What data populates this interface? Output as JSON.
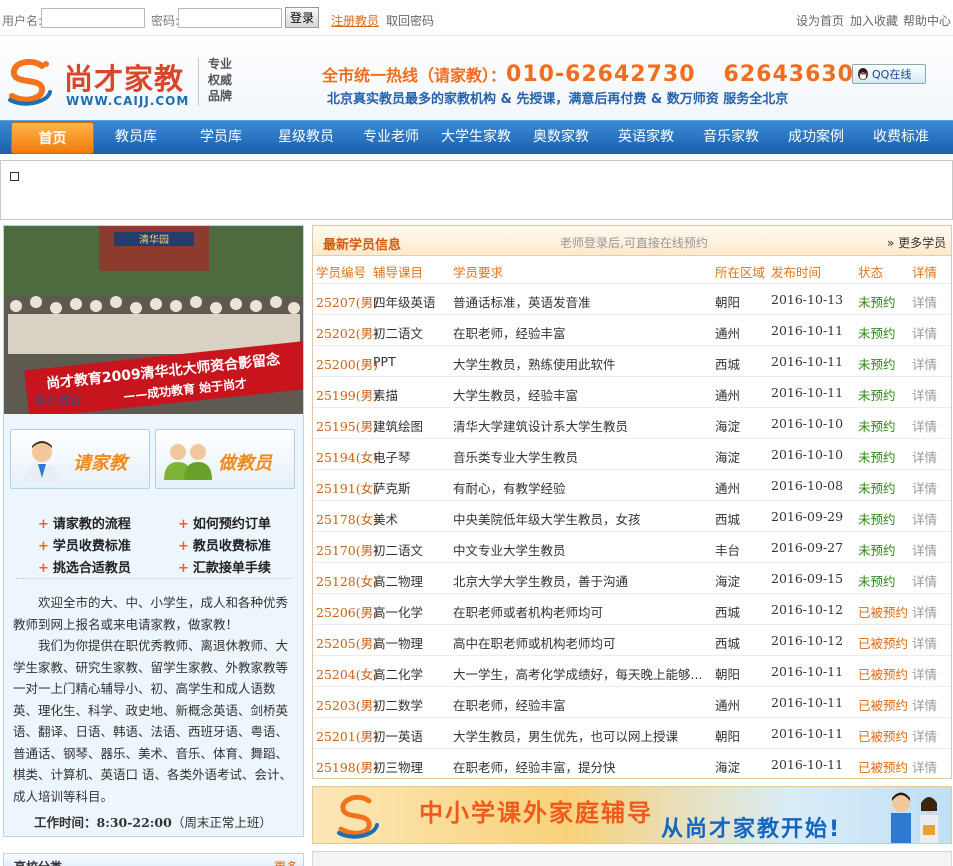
{
  "topbar": {
    "username_label": "用户名:",
    "password_label": "密码:",
    "login_button": "登录",
    "register_link": "注册教员",
    "recover_link": "取回密码",
    "links": [
      "设为首页",
      "加入收藏",
      "帮助中心"
    ]
  },
  "header": {
    "logo_text": "尚才家教",
    "logo_url": "WWW.CAIJJ.COM",
    "slogan": [
      "专业",
      "权威",
      "品牌"
    ],
    "hotline_label": "全市统一热线（请家教）：",
    "hotline_1": "010-62642730",
    "hotline_2": "62643630",
    "subline": "北京真实教员最多的家教机构 & 先授课，满意后再付费 & 数万师资 服务全北京",
    "qq_button": "QQ在线"
  },
  "nav": {
    "items": [
      "首页",
      "教员库",
      "学员库",
      "星级教员",
      "专业老师",
      "大学生家教",
      "奥数家教",
      "英语家教",
      "音乐家教",
      "成功案例",
      "收费标准"
    ]
  },
  "left": {
    "photo_caption_1": "尚才教育2009清华北大师资合影留念",
    "photo_caption_2": "——成功教育 始于尚才",
    "photo_gate": "清华园",
    "photo_watermark": "尚才教育",
    "btn_request": "请家教",
    "btn_teacher": "做教员",
    "links": [
      "请家教的流程",
      "如何预约订单",
      "学员收费标准",
      "教员收费标准",
      "挑选合适教员",
      "汇款接单手续"
    ],
    "intro_1": "欢迎全市的大、中、小学生，成人和各种优秀教师到网上报名或来电请家教，做家教！",
    "intro_2": "我们为你提供在职优秀教师、离退休教师、大学生家教、研究生家教、留学生家教、外教家教等一对一上门精心辅导小、初、高学生和成人语数英、理化生、科学、政史地、新概念英语、剑桥英语、翻译、日语、韩语、法语、西班牙语、粤语、普通话、钢琴、器乐、美术、音乐、体育、舞蹈、棋类、计算机、英语口 语、各类外语考试、会计、成人培训等科目。",
    "worktime_label": "工作时间：",
    "worktime_value": "8:30-22:00",
    "worktime_note": "（周末正常上班）",
    "bottom_title": "高校分类",
    "bottom_more": "更多"
  },
  "panel": {
    "title": "最新学员信息",
    "center_note": "老师登录后,可直接在线预约",
    "more": "» 更多学员",
    "columns": [
      "学员编号",
      "辅导课目",
      "学员要求",
      "所在区域",
      "发布时间",
      "状态",
      "详情"
    ],
    "rows": [
      {
        "id": "25207(男)",
        "course": "四年级英语",
        "req": "普通话标准，英语发音准",
        "area": "朝阳",
        "date": "2016-10-13",
        "status": "未预约",
        "detail": "详情"
      },
      {
        "id": "25202(男)",
        "course": "初二语文",
        "req": "在职老师，经验丰富",
        "area": "通州",
        "date": "2016-10-11",
        "status": "未预约",
        "detail": "详情"
      },
      {
        "id": "25200(男)",
        "course": "PPT",
        "req": "大学生教员，熟练使用此软件",
        "area": "西城",
        "date": "2016-10-11",
        "status": "未预约",
        "detail": "详情"
      },
      {
        "id": "25199(男)",
        "course": "素描",
        "req": "大学生教员，经验丰富",
        "area": "通州",
        "date": "2016-10-11",
        "status": "未预约",
        "detail": "详情"
      },
      {
        "id": "25195(男)",
        "course": "建筑绘图",
        "req": "清华大学建筑设计系大学生教员",
        "area": "海淀",
        "date": "2016-10-10",
        "status": "未预约",
        "detail": "详情"
      },
      {
        "id": "25194(女)",
        "course": "电子琴",
        "req": "音乐类专业大学生教员",
        "area": "海淀",
        "date": "2016-10-10",
        "status": "未预约",
        "detail": "详情"
      },
      {
        "id": "25191(女)",
        "course": "萨克斯",
        "req": "有耐心，有教学经验",
        "area": "通州",
        "date": "2016-10-08",
        "status": "未预约",
        "detail": "详情"
      },
      {
        "id": "25178(女)",
        "course": "美术",
        "req": "中央美院低年级大学生教员，女孩",
        "area": "西城",
        "date": "2016-09-29",
        "status": "未预约",
        "detail": "详情"
      },
      {
        "id": "25170(男)",
        "course": "初二语文",
        "req": "中文专业大学生教员",
        "area": "丰台",
        "date": "2016-09-27",
        "status": "未预约",
        "detail": "详情"
      },
      {
        "id": "25128(女)",
        "course": "高二物理",
        "req": "北京大学大学生教员，善于沟通",
        "area": "海淀",
        "date": "2016-09-15",
        "status": "未预约",
        "detail": "详情"
      },
      {
        "id": "25206(男)",
        "course": "高一化学",
        "req": "在职老师或者机构老师均可",
        "area": "西城",
        "date": "2016-10-12",
        "status": "已被预约",
        "detail": "详情"
      },
      {
        "id": "25205(男)",
        "course": "高一物理",
        "req": "高中在职老师或机构老师均可",
        "area": "西城",
        "date": "2016-10-12",
        "status": "已被预约",
        "detail": "详情"
      },
      {
        "id": "25204(女)",
        "course": "高二化学",
        "req": "大一学生，高考化学成绩好，每天晚上能够...",
        "area": "朝阳",
        "date": "2016-10-11",
        "status": "已被预约",
        "detail": "详情"
      },
      {
        "id": "25203(男)",
        "course": "初二数学",
        "req": "在职老师，经验丰富",
        "area": "通州",
        "date": "2016-10-11",
        "status": "已被预约",
        "detail": "详情"
      },
      {
        "id": "25201(男)",
        "course": "初一英语",
        "req": "大学生教员，男生优先，也可以网上授课",
        "area": "朝阳",
        "date": "2016-10-11",
        "status": "已被预约",
        "detail": "详情"
      },
      {
        "id": "25198(男)",
        "course": "初三物理",
        "req": "在职老师，经验丰富，提分快",
        "area": "海淀",
        "date": "2016-10-11",
        "status": "已被预约",
        "detail": "详情"
      }
    ]
  },
  "banner": {
    "text_1": "中小学课外家庭辅导",
    "text_2": "从尚才家教开始!"
  },
  "colors": {
    "nav_blue": "#1a5fac",
    "accent_orange": "#f26d1c",
    "status_open": "#2f8a14",
    "status_booked": "#e06a10"
  }
}
